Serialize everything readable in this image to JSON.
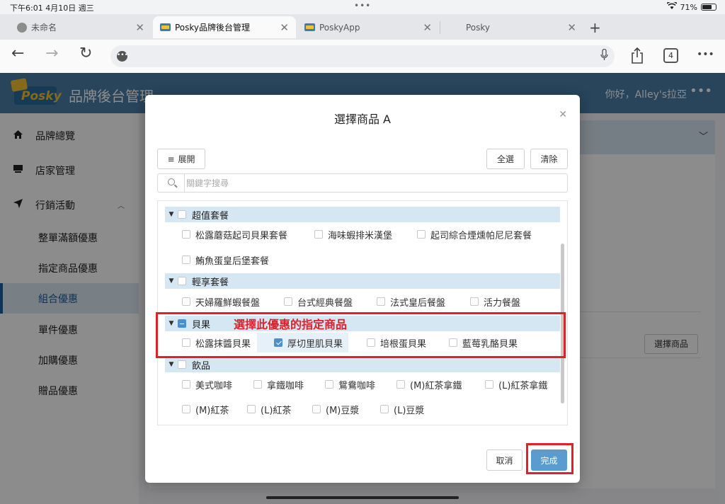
{
  "status_bar": {
    "time": "下午6:01  4月10日 週三",
    "battery": "71%",
    "wifi_icon": "wifi-icon",
    "battery_level": 0.71
  },
  "browser": {
    "tabs": [
      {
        "label": "未命名",
        "favicon": "globe-icon"
      },
      {
        "label": "Posky品牌後台管理",
        "favicon": "posky-icon",
        "active": true
      },
      {
        "label": "PoskyApp",
        "favicon": "posky-icon"
      },
      {
        "label": "Posky",
        "favicon": "none"
      }
    ],
    "new_tab": "+",
    "back": "←",
    "forward": "→",
    "reload": "↻",
    "tab_count": "4",
    "share_icon": "share-icon",
    "more": "•••"
  },
  "app": {
    "logo_text": "Posky",
    "title": "品牌後台管理",
    "greeting": "你好，Alley's拉亞",
    "more": "•••",
    "menu": [
      {
        "label": "品牌總覽",
        "icon": "home-icon"
      },
      {
        "label": "店家管理",
        "icon": "store-icon"
      },
      {
        "label": "行銷活動",
        "icon": "send-icon",
        "expanded": true
      },
      {
        "label": "整單滿額優惠"
      },
      {
        "label": "指定商品優惠"
      },
      {
        "label": "組合優惠",
        "selected": true
      },
      {
        "label": "單件優惠"
      },
      {
        "label": "加購優惠"
      },
      {
        "label": "贈品優惠"
      }
    ],
    "select_products_button": "選擇商品"
  },
  "modal": {
    "title": "選擇商品 A",
    "expand_button": "展開",
    "select_all_button": "全選",
    "clear_button": "清除",
    "search_placeholder": "關鍵字搜尋",
    "groups": [
      {
        "name": "超值套餐",
        "state": "unchecked",
        "items": [
          {
            "label": "松露蘑菇起司貝果套餐",
            "checked": false
          },
          {
            "label": "海味蝦排米漢堡",
            "checked": false
          },
          {
            "label": "起司綜合煙燻帕尼尼套餐",
            "checked": false
          },
          {
            "label": "鮪魚蛋皇后堡套餐",
            "checked": false
          }
        ]
      },
      {
        "name": "輕享套餐",
        "state": "unchecked",
        "items": [
          {
            "label": "天婦羅鮮蝦餐盤",
            "checked": false
          },
          {
            "label": "台式經典餐盤",
            "checked": false
          },
          {
            "label": "法式皇后餐盤",
            "checked": false
          },
          {
            "label": "活力餐盤",
            "checked": false
          }
        ]
      },
      {
        "name": "貝果",
        "state": "partial",
        "items": [
          {
            "label": "松露抹醬貝果",
            "checked": false
          },
          {
            "label": "厚切里肌貝果",
            "checked": true
          },
          {
            "label": "培根蛋貝果",
            "checked": false
          },
          {
            "label": "藍莓乳酪貝果",
            "checked": false
          }
        ]
      },
      {
        "name": "飲品",
        "state": "unchecked",
        "items": [
          {
            "label": "美式咖啡",
            "checked": false
          },
          {
            "label": "拿鐵咖啡",
            "checked": false
          },
          {
            "label": "鴛鴦咖啡",
            "checked": false
          },
          {
            "label": "(M)紅茶拿鐵",
            "checked": false
          },
          {
            "label": "(L)紅茶拿鐵",
            "checked": false
          },
          {
            "label": "(M)紅茶",
            "checked": false
          },
          {
            "label": "(L)紅茶",
            "checked": false
          },
          {
            "label": "(M)豆漿",
            "checked": false
          },
          {
            "label": "(L)豆漿",
            "checked": false
          }
        ]
      }
    ],
    "cancel_button": "取消",
    "done_button": "完成"
  },
  "annotation": {
    "text": "選擇此優惠的指定商品",
    "color": "#e0202a"
  },
  "colors": {
    "header": "#4a7fa8",
    "primary": "#5a9bd0",
    "group_row": "#d6e7f4"
  }
}
